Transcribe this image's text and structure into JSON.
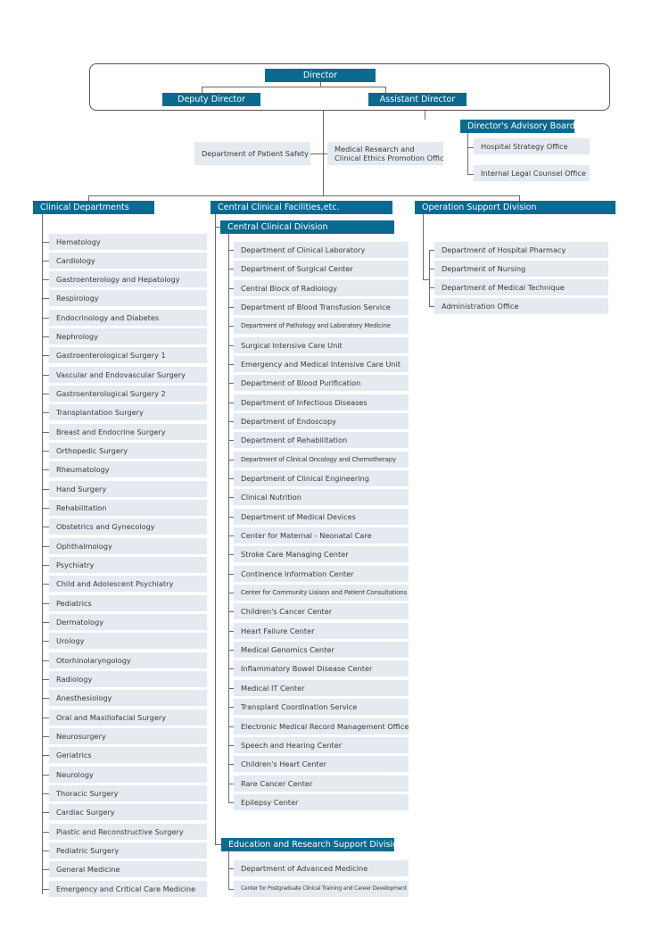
{
  "top": {
    "director": "Director",
    "deputy_director": "Deputy Director",
    "assistant_director": "Assistant Director"
  },
  "advisory": {
    "header": "Director's Advisory Board",
    "items": [
      "Hospital Strategy Office",
      "Internal Legal Counsel Office"
    ]
  },
  "staff": {
    "patient_safety": "Department of Patient Safety",
    "research_ethics_line1": "Medical Research and",
    "research_ethics_line2": "Clinical Ethics Promotion Office"
  },
  "clinical": {
    "header": "Clinical Departments",
    "items": [
      "Hematology",
      "Cardiology",
      "Gastroenterology and Hepatology",
      "Respirology",
      "Endocrinology and Diabetes",
      "Nephrology",
      "Gastroenterological Surgery 1",
      "Vascular and Endovascular Surgery",
      "Gastroenterological Surgery 2",
      "Transplantation Surgery",
      "Breast and Endocrine Surgery",
      "Orthopedic Surgery",
      "Rheumatology",
      "Hand Surgery",
      "Rehabilitation",
      "Obstetrics and Gynecology",
      "Ophthalmology",
      "Psychiatry",
      "Child and Adolescent Psychiatry",
      "Pediatrics",
      "Dermatology",
      "Urology",
      "Otorhinolaryngology",
      "Radiology",
      "Anesthesiology",
      "Oral and Maxillofacial Surgery",
      "Neurosurgery",
      "Geriatrics",
      "Neurology",
      "Thoracic Surgery",
      "Cardiac Surgery",
      "Plastic and Reconstructive Surgery",
      "Pediatric Surgery",
      "General Medicine",
      "Emergency and Critical Care Medicine"
    ]
  },
  "central": {
    "header": "Central Clinical Facilities,etc.",
    "division": {
      "header": "Central Clinical Division",
      "items": [
        "Department of Clinical Laboratory",
        "Department of Surgical Center",
        "Central Block of Radiology",
        "Department of Blood Transfusion Service",
        "Department of Pathology and Laboratory Medicine",
        "Surgical Intensive Care Unit",
        "Emergency and Medical Intensive Care Unit",
        "Department of Blood Purification",
        "Department of Infectious Diseases",
        "Department of Endoscopy",
        "Department of Rehabilitation",
        "Department of Clinical Oncology and Chemotherapy",
        "Department of Clinical Engineering",
        "Clinical Nutrition",
        "Department of Medical Devices",
        "Center for Maternal - Neonatal Care",
        "Stroke Care Managing Center",
        "Continence Information Center",
        "Center for Community Liaison and Patient Consultations",
        "Children's Cancer Center",
        "Heart Failure Center",
        "Medical Genomics Center",
        "Inflammatory Bowel Disease Center",
        "Medical IT Center",
        "Transplant Coordination Service",
        "Electronic Medical Record  Management  Office",
        "Speech and Hearing Center",
        "Children's Heart Center",
        "Rare Cancer Center",
        "Epilepsy Center"
      ]
    },
    "education": {
      "header": "Education and Research Support Division",
      "items": [
        "Department of Advanced Medicine",
        "Center for Postgraduate Clinical Training and Career Development"
      ]
    }
  },
  "operation": {
    "header": "Operation Support Division",
    "items": [
      "Department of Hospital Pharmacy",
      "Department of Nursing",
      "Department of Medical Technique",
      "Administration Office"
    ]
  }
}
